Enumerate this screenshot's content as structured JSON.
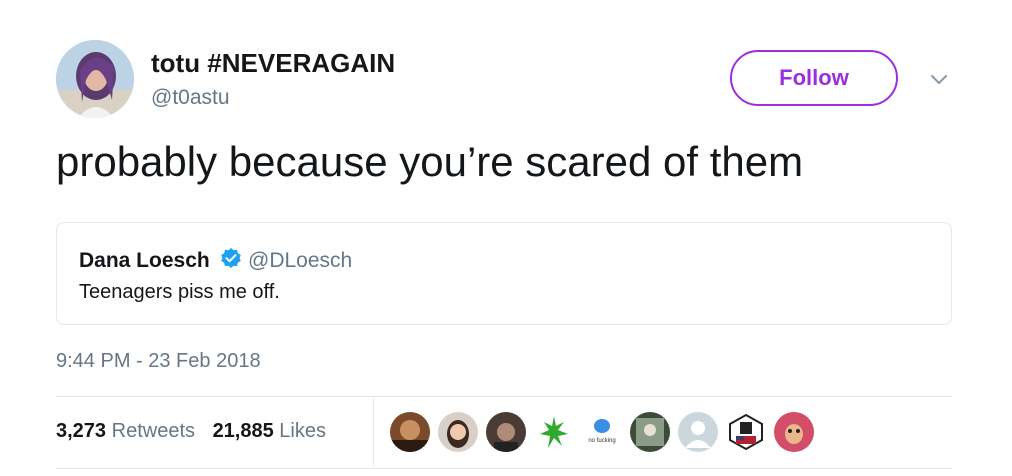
{
  "author": {
    "name": "totu #NEVERAGAIN",
    "handle": "@t0astu",
    "follow_label": "Follow"
  },
  "tweet": {
    "text": "probably because you’re scared of them"
  },
  "quoted_tweet": {
    "name": "Dana Loesch",
    "handle": "@DLoesch",
    "text": "Teenagers piss me off."
  },
  "timestamp": "9:44 PM - 23 Feb 2018",
  "stats": {
    "retweets_count": "3,273",
    "retweets_label": "Retweets",
    "likes_count": "21,885",
    "likes_label": "Likes"
  },
  "likers": {
    "avatar_9_text": "no fucking"
  },
  "colors": {
    "accent": "#9b2fe0",
    "verified": "#1da1f2",
    "secondary_text": "#657786",
    "border": "#e1e8ed"
  }
}
